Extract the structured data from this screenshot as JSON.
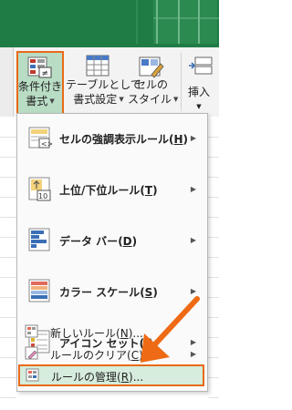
{
  "ribbon": {
    "conditional_formatting": {
      "line1": "条件付き",
      "line2": "書式"
    },
    "format_as_table": {
      "line1": "テーブルとして",
      "line2": "書式設定"
    },
    "cell_styles": {
      "line1": "セルの",
      "line2": "スタイル"
    },
    "insert": {
      "line1": "挿入"
    }
  },
  "menu": {
    "highlight_rules": {
      "label": "セルの強調表示ルール",
      "key": "H"
    },
    "top_bottom_rules": {
      "label": "上位/下位ルール",
      "key": "T",
      "icon_number": "10"
    },
    "data_bars": {
      "label": "データ バー",
      "key": "D"
    },
    "color_scales": {
      "label": "カラー スケール",
      "key": "S"
    },
    "icon_sets": {
      "label": "アイコン セット",
      "key": "I"
    },
    "new_rule": {
      "label": "新しいルール",
      "key": "N",
      "suffix": "..."
    },
    "clear_rules": {
      "label": "ルールのクリア",
      "key": "C"
    },
    "manage_rules": {
      "label": "ルールの管理",
      "key": "R",
      "suffix": "..."
    }
  },
  "colors": {
    "accent_orange": "#e86a1a",
    "selected_fill": "#b9dcc5",
    "hover_fill": "#d6ecdc",
    "sheet_green": "#1f7c45"
  }
}
